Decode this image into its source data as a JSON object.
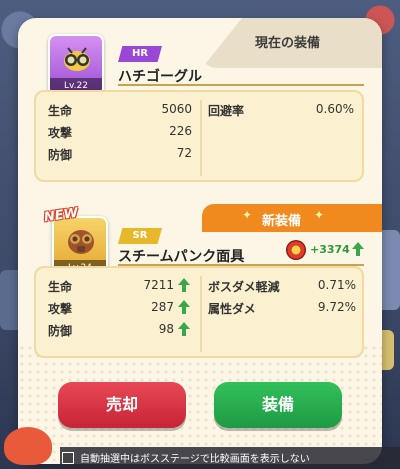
{
  "current": {
    "tab_label": "現在の装備",
    "rarity": "HR",
    "name": "ハチゴーグル",
    "level": "Lv.22",
    "stats_left": [
      {
        "label": "生命",
        "value": "5060"
      },
      {
        "label": "攻撃",
        "value": "226"
      },
      {
        "label": "防御",
        "value": "72"
      }
    ],
    "stats_right": [
      {
        "label": "回避率",
        "value": "0.60%"
      }
    ]
  },
  "new_item": {
    "tab_label": "新装備",
    "badge": "NEW",
    "rarity": "SR",
    "name": "スチームパンク面具",
    "level": "Lv.24",
    "power_change": "+3374",
    "stats_left": [
      {
        "label": "生命",
        "value": "7211"
      },
      {
        "label": "攻撃",
        "value": "287"
      },
      {
        "label": "防御",
        "value": "98"
      }
    ],
    "stats_right": [
      {
        "label": "ボスダメ軽減",
        "value": "0.71%"
      },
      {
        "label": "属性ダメ",
        "value": "9.72%"
      }
    ]
  },
  "buttons": {
    "sell": "売却",
    "equip": "装備"
  },
  "footer": {
    "text": "自動抽選中はボスステージで比較画面を表示しない"
  },
  "colors": {
    "hr": "#9b47d6",
    "sr": "#e8b82c",
    "new_tab": "#f08a1e",
    "sell": "#d83446",
    "equip": "#28ad4f",
    "up_arrow": "#3aa84a"
  },
  "icons": {
    "current_item": "bee-goggles-icon",
    "new_item": "steampunk-mask-icon",
    "power": "power-icon",
    "up_arrow": "arrow-up-icon",
    "sparkle": "sparkle-icon"
  }
}
